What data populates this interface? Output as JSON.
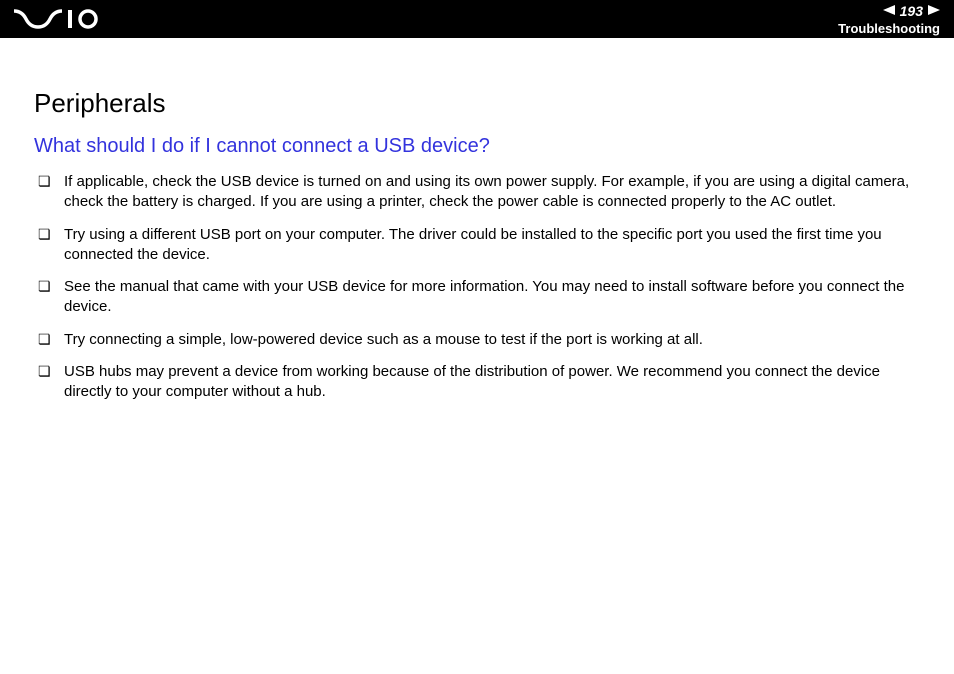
{
  "header": {
    "page_number": "193",
    "section": "Troubleshooting"
  },
  "content": {
    "title": "Peripherals",
    "subtitle": "What should I do if I cannot connect a USB device?",
    "bullets": [
      "If applicable, check the USB device is turned on and using its own power supply. For example, if you are using a digital camera, check the battery is charged. If you are using a printer, check the power cable is connected properly to the AC outlet.",
      "Try using a different USB port on your computer. The driver could be installed to the specific port you used the first time you connected the device.",
      "See the manual that came with your USB device for more information. You may need to install software before you connect the device.",
      "Try connecting a simple, low-powered device such as a mouse to test if the port is working at all.",
      "USB hubs may prevent a device from working because of the distribution of power. We recommend you connect the device directly to your computer without a hub."
    ]
  }
}
